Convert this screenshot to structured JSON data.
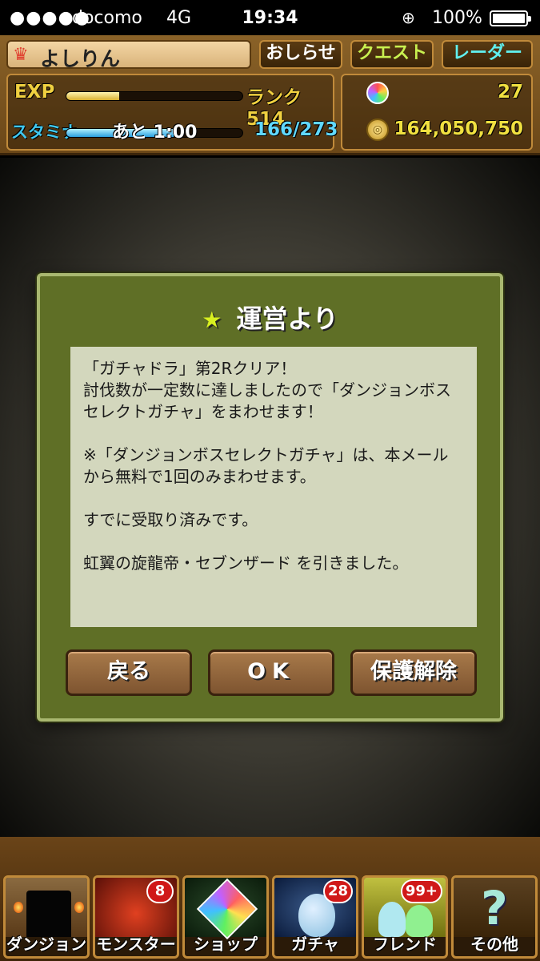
{
  "status_bar": {
    "signal": "●●●●●",
    "carrier": "docomo",
    "network": "4G",
    "time": "19:34",
    "battery_percent": "100%",
    "battery_level": 1.0
  },
  "header": {
    "player_name": "よしりん",
    "buttons": {
      "news": "おしらせ",
      "quest": "クエスト",
      "radar": "レーダー"
    },
    "exp_label": "EXP",
    "exp_progress": 0.3,
    "rank_text": "ランク 514",
    "stamina_label": "スタミナ",
    "stamina_time": "あと 1:00",
    "stamina_text": "166/273",
    "stamina_progress": 0.61,
    "magic_stones": "27",
    "coins": "164,050,750",
    "colors": {
      "exp_gold": "#f0d040",
      "stamina_blue": "#40c8f0",
      "quest_green": "#c8f050",
      "radar_cyan": "#60f0f0"
    }
  },
  "dialog": {
    "title": "運営より",
    "title_icon": "star-icon",
    "message": [
      "「ガチャドラ」第2Rクリア！\n討伐数が一定数に達しましたので「ダンジョンボスセレクトガチャ」をまわせます！",
      "※「ダンジョンボスセレクトガチャ」は、本メールから無料で1回のみまわせます。",
      "すでに受取り済みです。",
      "虹翼の旋龍帝・セブンザード を引きました。"
    ],
    "buttons": {
      "back": "戻る",
      "ok": "OK",
      "unprotect": "保護解除"
    },
    "colors": {
      "panel": "#5f6f26",
      "message_bg": "#d3d7bd"
    }
  },
  "bottom_nav": {
    "items": [
      {
        "label": "ダンジョン",
        "icon": "dungeon-gate-icon",
        "badge": ""
      },
      {
        "label": "モンスター",
        "icon": "dragon-icon",
        "badge": "8"
      },
      {
        "label": "ショップ",
        "icon": "rainbow-gem-icon",
        "badge": ""
      },
      {
        "label": "ガチャ",
        "icon": "egg-icon",
        "badge": "28"
      },
      {
        "label": "フレンド",
        "icon": "friends-icon",
        "badge": "99+"
      },
      {
        "label": "その他",
        "icon": "question-mark-icon",
        "badge": ""
      }
    ]
  }
}
